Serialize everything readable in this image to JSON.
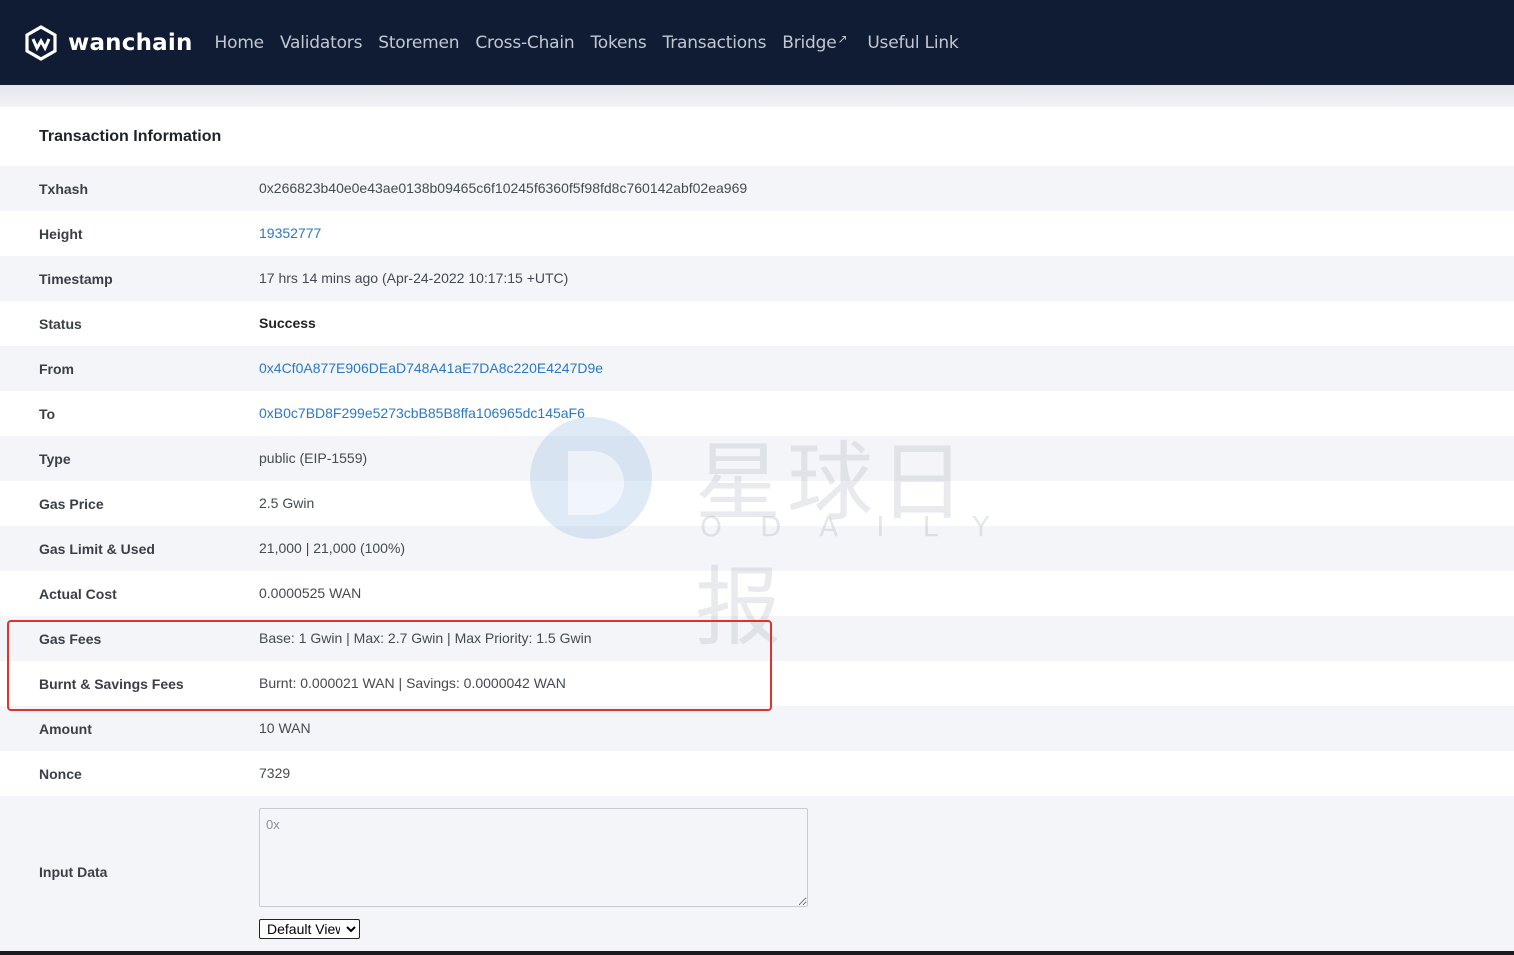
{
  "nav": {
    "brand": "wanchain",
    "items": [
      "Home",
      "Validators",
      "Storemen",
      "Cross-Chain",
      "Tokens",
      "Transactions",
      "Bridge"
    ],
    "bridge_ext_icon": "↗",
    "useful_link": "Useful Link"
  },
  "card": {
    "title": "Transaction Information",
    "rows": [
      {
        "label": "Txhash",
        "value": "0x266823b40e0e43ae0138b09465c6f10245f6360f5f98fd8c760142abf02ea969"
      },
      {
        "label": "Height",
        "value": "19352777"
      },
      {
        "label": "Timestamp",
        "value": "17 hrs 14 mins ago (Apr-24-2022 10:17:15 +UTC)"
      },
      {
        "label": "Status",
        "value": "Success"
      },
      {
        "label": "From",
        "value": "0x4Cf0A877E906DEaD748A41aE7DA8c220E4247D9e"
      },
      {
        "label": "To",
        "value": "0xB0c7BD8F299e5273cbB85B8ffa106965dc145aF6"
      },
      {
        "label": "Type",
        "value": "public (EIP-1559)"
      },
      {
        "label": "Gas Price",
        "value": "2.5 Gwin"
      },
      {
        "label": "Gas Limit & Used",
        "value": "21,000 | 21,000 (100%)"
      },
      {
        "label": "Actual Cost",
        "value": "0.0000525 WAN"
      },
      {
        "label": "Gas Fees",
        "value": "Base: 1 Gwin | Max: 2.7 Gwin | Max Priority: 1.5 Gwin"
      },
      {
        "label": "Burnt & Savings Fees",
        "value": "Burnt: 0.000021 WAN | Savings: 0.0000042 WAN"
      },
      {
        "label": "Amount",
        "value": "10 WAN"
      },
      {
        "label": "Nonce",
        "value": "7329"
      }
    ],
    "input_data": {
      "label": "Input Data",
      "value": "0x",
      "view_selected": "Default View"
    }
  },
  "watermark": {
    "cn": "星球日报",
    "en": "ODAILY"
  },
  "colors": {
    "nav_bg": "#101c33",
    "link": "#2a79c4",
    "highlight": "#e0332b"
  }
}
